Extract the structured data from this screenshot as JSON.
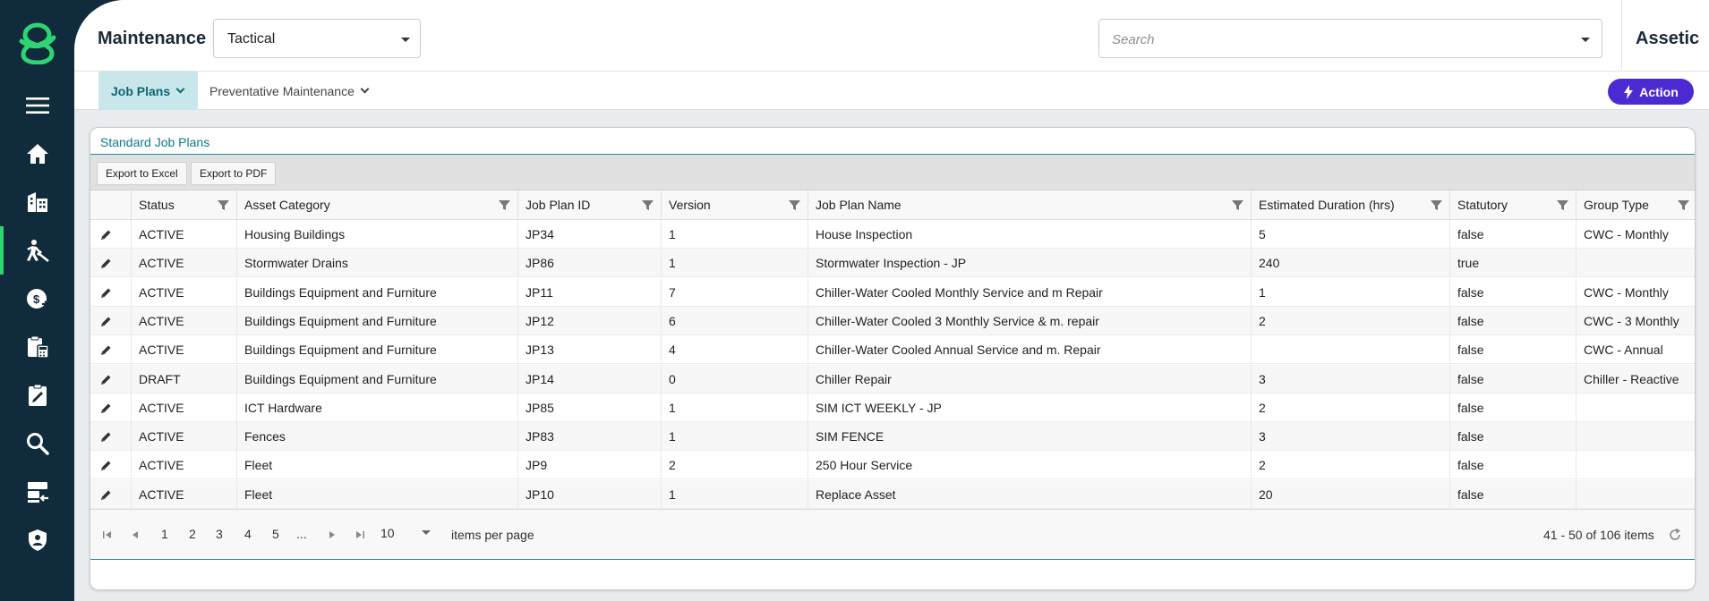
{
  "header": {
    "module_title": "Maintenance",
    "module_select": "Tactical",
    "search_placeholder": "Search",
    "brand": "Assetic"
  },
  "sidebar": {
    "items": [
      {
        "icon": "menu-icon"
      },
      {
        "icon": "home-icon"
      },
      {
        "icon": "buildings-icon"
      },
      {
        "icon": "maintenance-worker-icon",
        "active": true
      },
      {
        "icon": "finance-icon"
      },
      {
        "icon": "clipboard-calculator-icon"
      },
      {
        "icon": "clipboard-edit-icon"
      },
      {
        "icon": "search-icon"
      },
      {
        "icon": "server-import-icon"
      },
      {
        "icon": "shield-user-icon"
      }
    ]
  },
  "subnav": {
    "tabs": [
      {
        "label": "Job Plans",
        "active": true
      },
      {
        "label": "Preventative Maintenance",
        "active": false
      }
    ],
    "action_label": "Action"
  },
  "card": {
    "title": "Standard Job Plans",
    "toolbar": {
      "export_excel": "Export to Excel",
      "export_pdf": "Export to PDF"
    },
    "columns": [
      {
        "key": "status",
        "label": "Status"
      },
      {
        "key": "asset_category",
        "label": "Asset Category"
      },
      {
        "key": "job_plan_id",
        "label": "Job Plan ID"
      },
      {
        "key": "version",
        "label": "Version"
      },
      {
        "key": "job_plan_name",
        "label": "Job Plan Name"
      },
      {
        "key": "estimated_duration",
        "label": "Estimated Duration (hrs)"
      },
      {
        "key": "statutory",
        "label": "Statutory"
      },
      {
        "key": "group_type",
        "label": "Group Type"
      }
    ],
    "rows": [
      [
        "ACTIVE",
        "Housing Buildings",
        "JP34",
        "1",
        "House Inspection",
        "5",
        "false",
        "CWC - Monthly"
      ],
      [
        "ACTIVE",
        "Stormwater Drains",
        "JP86",
        "1",
        "Stormwater Inspection - JP",
        "240",
        "true",
        ""
      ],
      [
        "ACTIVE",
        "Buildings Equipment and Furniture",
        "JP11",
        "7",
        "Chiller-Water Cooled Monthly Service and m Repair",
        "1",
        "false",
        "CWC - Monthly"
      ],
      [
        "ACTIVE",
        "Buildings Equipment and Furniture",
        "JP12",
        "6",
        "Chiller-Water Cooled 3 Monthly Service & m. repair",
        "2",
        "false",
        "CWC - 3 Monthly"
      ],
      [
        "ACTIVE",
        "Buildings Equipment and Furniture",
        "JP13",
        "4",
        "Chiller-Water Cooled Annual Service and m. Repair",
        "",
        "false",
        "CWC - Annual"
      ],
      [
        "DRAFT",
        "Buildings Equipment and Furniture",
        "JP14",
        "0",
        "Chiller Repair",
        "3",
        "false",
        "Chiller - Reactive"
      ],
      [
        "ACTIVE",
        "ICT Hardware",
        "JP85",
        "1",
        "SIM ICT WEEKLY - JP",
        "2",
        "false",
        ""
      ],
      [
        "ACTIVE",
        "Fences",
        "JP83",
        "1",
        "SIM FENCE",
        "3",
        "false",
        ""
      ],
      [
        "ACTIVE",
        "Fleet",
        "JP9",
        "2",
        "250 Hour Service",
        "2",
        "false",
        ""
      ],
      [
        "ACTIVE",
        "Fleet",
        "JP10",
        "1",
        "Replace Asset",
        "20",
        "false",
        ""
      ]
    ],
    "pager": {
      "pages": [
        "1",
        "2",
        "3",
        "4",
        "5",
        "..."
      ],
      "page_size": "10",
      "items_per_page_label": "items per page",
      "info": "41 - 50 of 106 items"
    }
  },
  "colors": {
    "sidebar_bg": "#0f2b3c",
    "accent_green": "#2ed573",
    "teal": "#0d7a8c",
    "action_purple": "#4b2bd1"
  }
}
